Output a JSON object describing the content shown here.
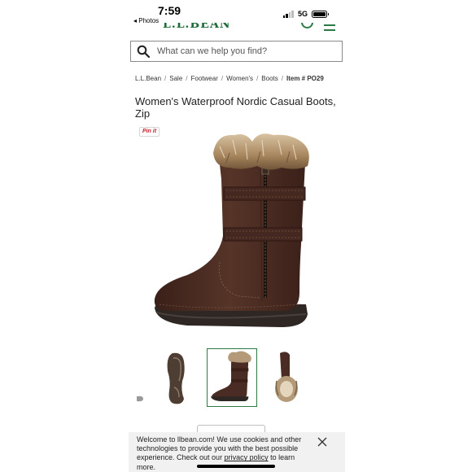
{
  "status_bar": {
    "time": "7:59",
    "back_label": "◂ Photos",
    "network": "5G"
  },
  "header": {
    "logo_text": "L.L.BEAN"
  },
  "search": {
    "placeholder": "What can we help you find?"
  },
  "breadcrumb": {
    "items": [
      "L.L.Bean",
      "Sale",
      "Footwear",
      "Women's",
      "Boots"
    ],
    "current": "Item # PO29"
  },
  "product": {
    "title": "Women's Waterproof Nordic Casual Boots, Zip",
    "pin_label": "Pin it"
  },
  "cookie_banner": {
    "text_before": "Welcome to llbean.com! We use cookies and other technologies to provide you with the best possible experience. Check out our ",
    "link_text": "privacy policy",
    "text_after": " to learn more."
  },
  "colors": {
    "brand_green": "#2b7a46",
    "boot_brown": "#4a2c25",
    "fur": "#b49a78"
  }
}
